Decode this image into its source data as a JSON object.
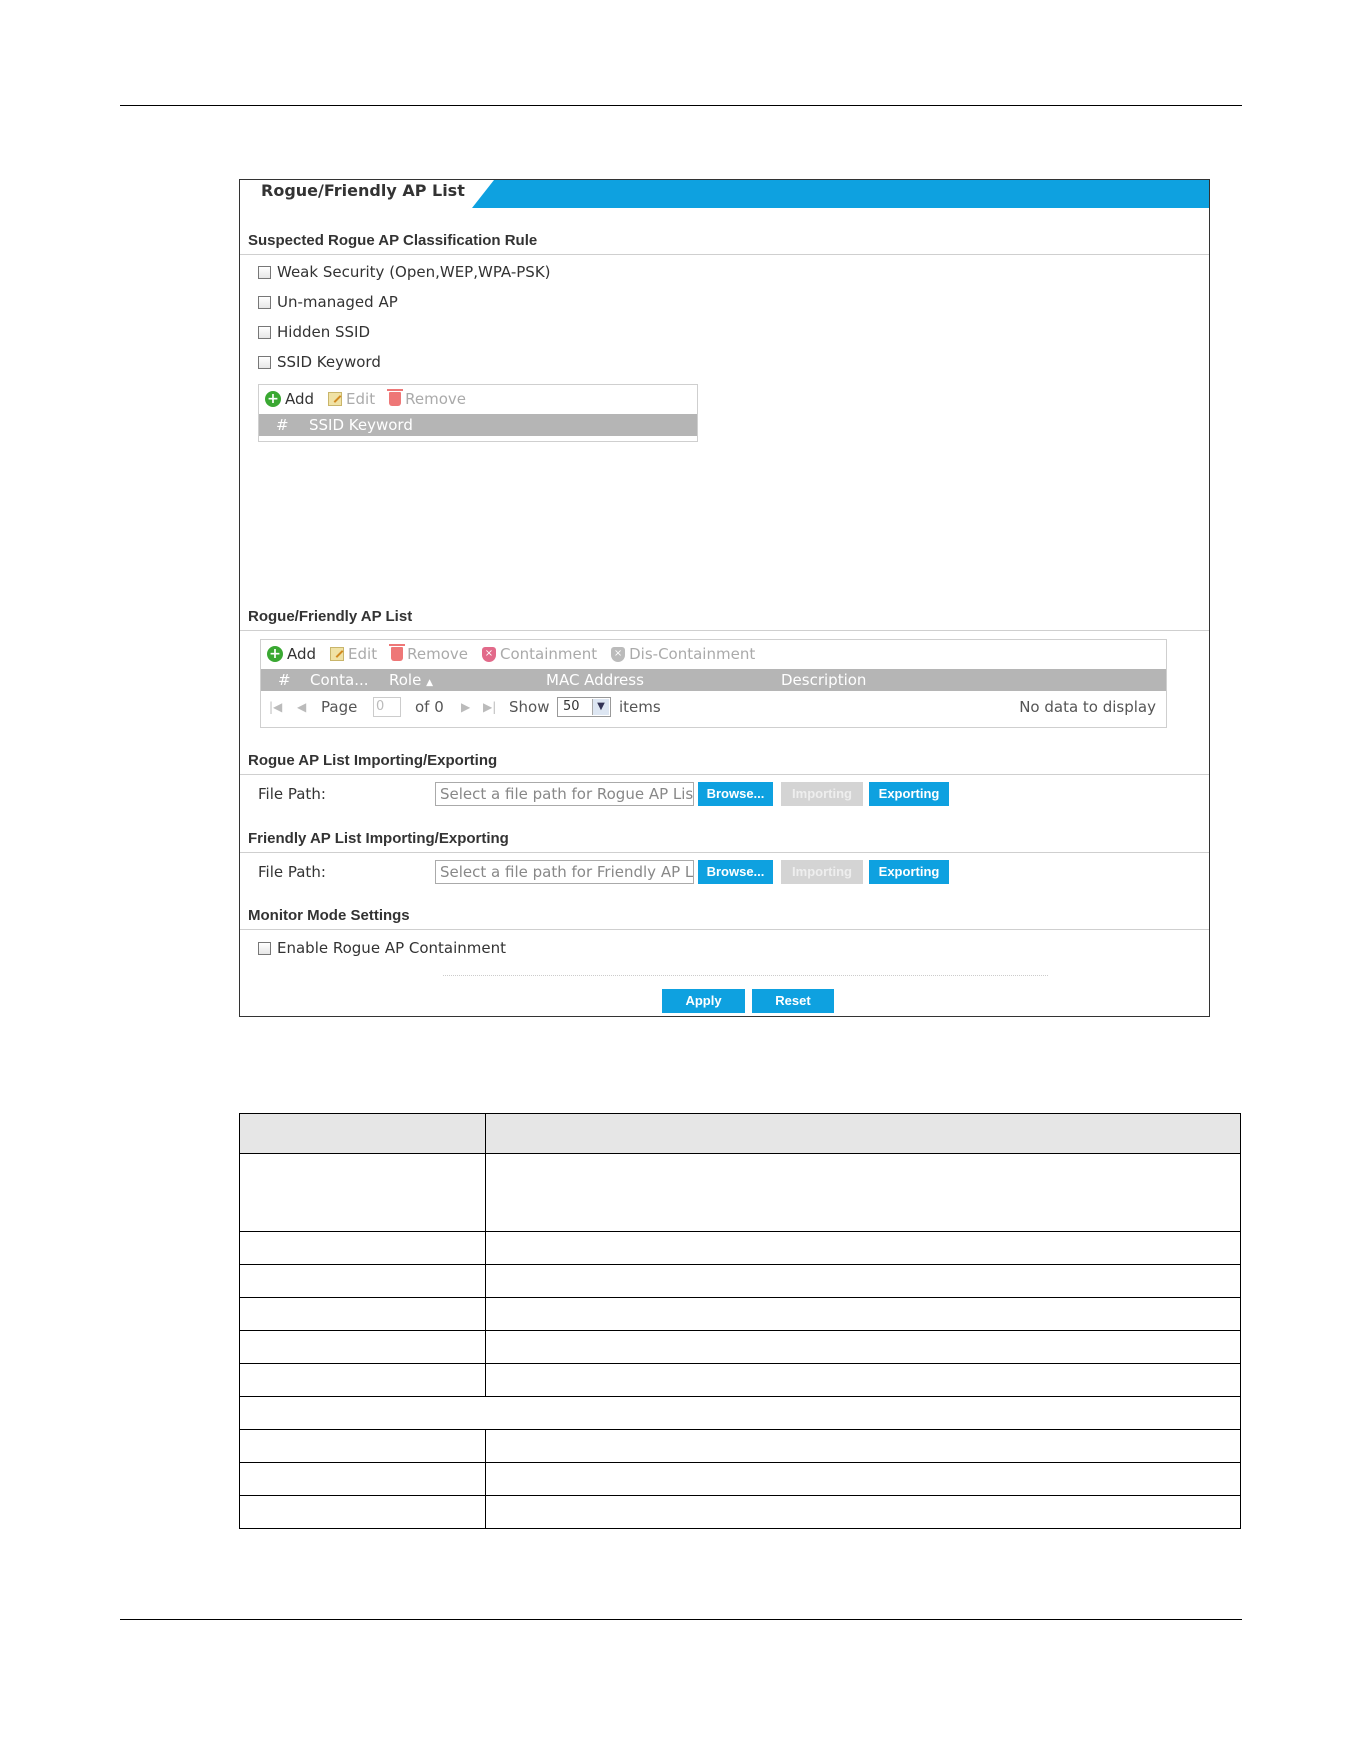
{
  "panel": {
    "tab_label": "Rogue/Friendly AP List",
    "classification": {
      "title": "Suspected Rogue AP Classification Rule",
      "options": [
        {
          "label": "Weak Security (Open,WEP,WPA-PSK)",
          "checked": false
        },
        {
          "label": "Un-managed AP",
          "checked": false
        },
        {
          "label": "Hidden SSID",
          "checked": false
        },
        {
          "label": "SSID Keyword",
          "checked": false
        }
      ],
      "toolbar": {
        "add": "Add",
        "edit": "Edit",
        "remove": "Remove"
      },
      "columns": {
        "index": "#",
        "keyword": "SSID Keyword"
      }
    },
    "ap_list": {
      "title": "Rogue/Friendly AP List",
      "toolbar": {
        "add": "Add",
        "edit": "Edit",
        "remove": "Remove",
        "containment": "Containment",
        "dis_containment": "Dis-Containment"
      },
      "columns": {
        "index": "#",
        "containment": "Conta...",
        "role": "Role",
        "role_sort": "▲",
        "mac": "MAC Address",
        "description": "Description"
      },
      "pager": {
        "page_label": "Page",
        "page_value": "0",
        "of_label": "of 0",
        "show_label": "Show",
        "show_value": "50",
        "items_label": "items",
        "empty_text": "No data to display"
      }
    },
    "rogue_import": {
      "title": "Rogue AP List Importing/Exporting",
      "label": "File Path:",
      "placeholder": "Select a file path for Rogue AP List",
      "browse": "Browse...",
      "importing": "Importing",
      "exporting": "Exporting"
    },
    "friendly_import": {
      "title": "Friendly AP List Importing/Exporting",
      "label": "File Path:",
      "placeholder": "Select a file path for Friendly AP List",
      "browse": "Browse...",
      "importing": "Importing",
      "exporting": "Exporting"
    },
    "monitor": {
      "title": "Monitor Mode Settings",
      "containment_label": "Enable Rogue AP Containment",
      "checked": false
    },
    "actions": {
      "apply": "Apply",
      "reset": "Reset"
    }
  },
  "colors": {
    "accent": "#0ea1e0",
    "grid_header": "#b5b5b5",
    "add_green": "#3aa832"
  }
}
